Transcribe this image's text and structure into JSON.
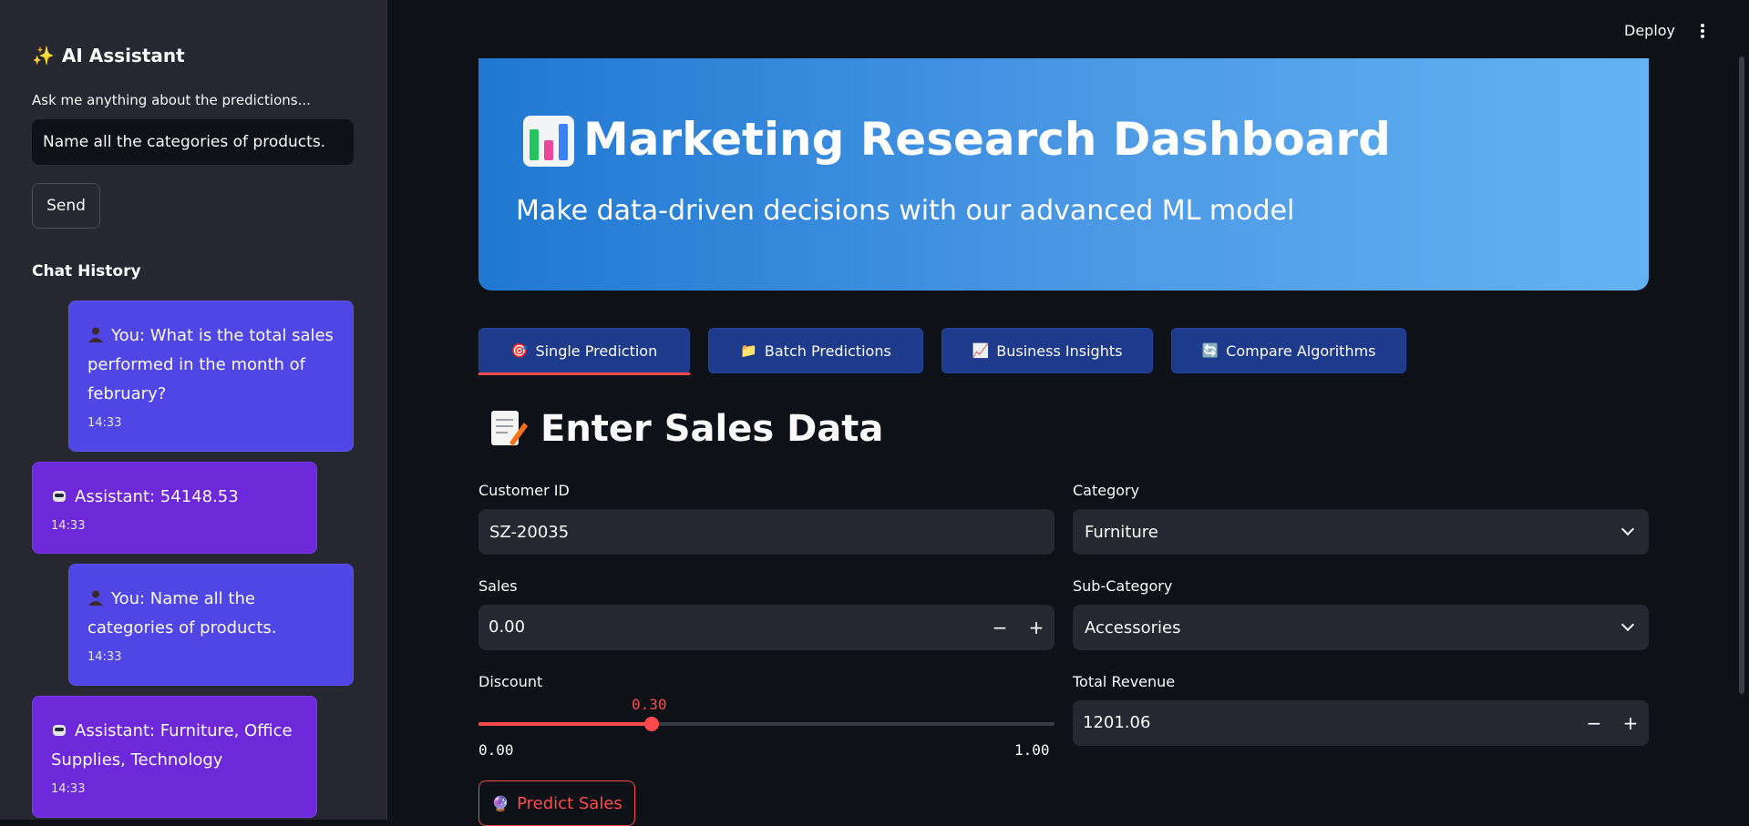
{
  "sidebar": {
    "title": "AI Assistant",
    "title_icon": "sparkles-icon",
    "ask_label": "Ask me anything about the predictions...",
    "input_value": "Name all the categories of products.",
    "send_label": "Send",
    "history_title": "Chat History",
    "messages": [
      {
        "role": "user",
        "text": "You: What is the total sales performed in the month of february?",
        "time": "14:33"
      },
      {
        "role": "assistant",
        "text": "Assistant: 54148.53",
        "time": "14:33"
      },
      {
        "role": "user",
        "text": "You: Name all the categories of products.",
        "time": "14:33"
      },
      {
        "role": "assistant",
        "text": "Assistant: Furniture, Office Supplies, Technology",
        "time": "14:33"
      }
    ]
  },
  "header": {
    "deploy_label": "Deploy"
  },
  "banner": {
    "title": "Marketing Research Dashboard",
    "subtitle": "Make data-driven decisions with our advanced ML model",
    "gradient_start": "#1f78d1",
    "gradient_end": "#63b3f2"
  },
  "tabs": [
    {
      "label": "Single Prediction",
      "icon": "target-icon",
      "glyph": "🎯",
      "active": true
    },
    {
      "label": "Batch Predictions",
      "icon": "folder-icon",
      "glyph": "📁",
      "active": false
    },
    {
      "label": "Business Insights",
      "icon": "chart-icon",
      "glyph": "📈",
      "active": false
    },
    {
      "label": "Compare Algorithms",
      "icon": "refresh-icon",
      "glyph": "🔄",
      "active": false
    }
  ],
  "section": {
    "title": "Enter Sales Data",
    "icon": "memo-icon"
  },
  "form": {
    "customer_id_label": "Customer ID",
    "customer_id_value": "SZ-20035",
    "category_label": "Category",
    "category_value": "Furniture",
    "sales_label": "Sales",
    "sales_value": "0.00",
    "sub_category_label": "Sub-Category",
    "sub_category_value": "Accessories",
    "discount_label": "Discount",
    "discount_value": "0.30",
    "discount_fraction": 0.3,
    "discount_min": "0.00",
    "discount_max": "1.00",
    "total_revenue_label": "Total Revenue",
    "total_revenue_value": "1201.06",
    "minus": "−",
    "plus": "+"
  },
  "predict_label": "Predict Sales",
  "colors": {
    "accent": "#ff4b4b",
    "tab_bg": "#1e3a8a",
    "user_msg": "#4f46e5",
    "assistant_msg": "#6d28d9",
    "sidebar_bg": "#262730",
    "app_bg": "#0e1117"
  }
}
